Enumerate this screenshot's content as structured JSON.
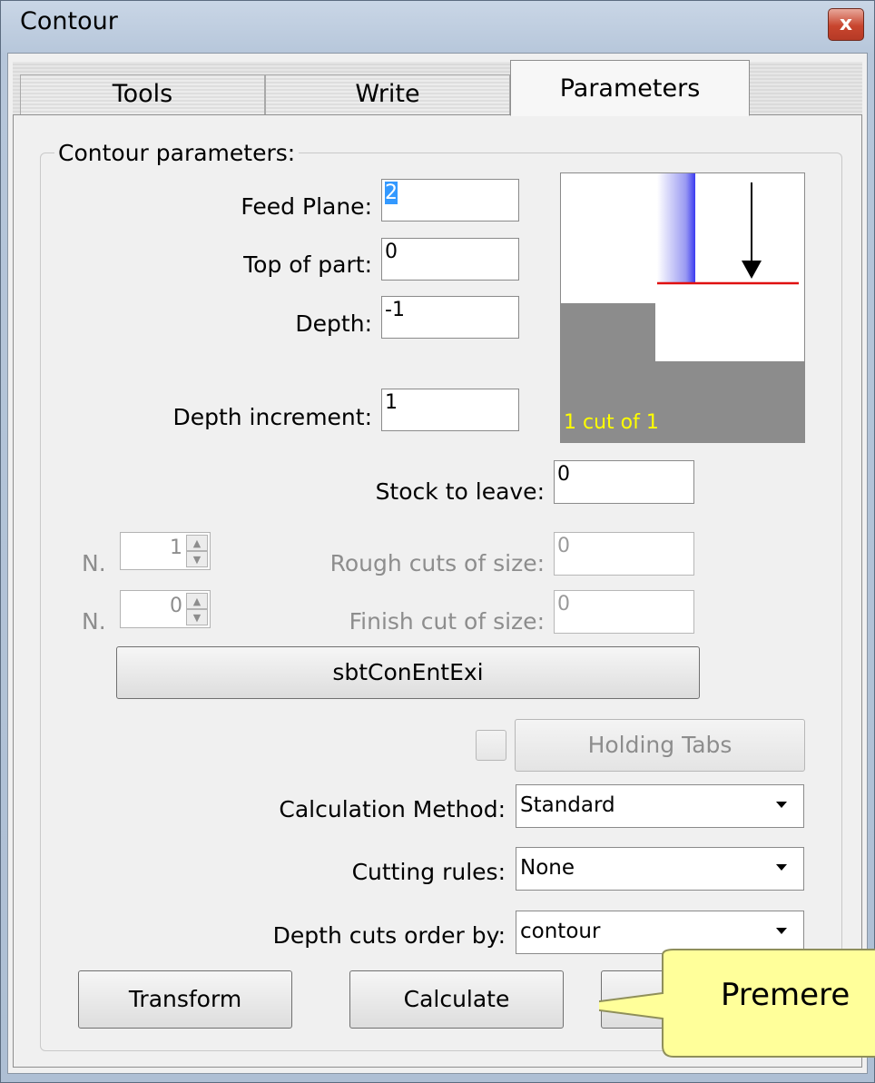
{
  "window": {
    "title": "Contour",
    "close_glyph": "x"
  },
  "tabs": [
    {
      "label": "Tools",
      "active": false
    },
    {
      "label": "Write",
      "active": false
    },
    {
      "label": "Parameters",
      "active": true
    }
  ],
  "group": {
    "label": "Contour parameters:"
  },
  "fields": {
    "feed_plane": {
      "label": "Feed Plane:",
      "value": "2"
    },
    "top_of_part": {
      "label": "Top of part:",
      "value": "0"
    },
    "depth": {
      "label": "Depth:",
      "value": "-1"
    },
    "depth_increment": {
      "label": "Depth increment:",
      "value": "1"
    },
    "stock_to_leave": {
      "label": "Stock to leave:",
      "value": "0"
    },
    "rough_cuts": {
      "label": "Rough cuts of size:",
      "value": "0"
    },
    "finish_cut": {
      "label": "Finish cut of size:",
      "value": "0"
    }
  },
  "preview": {
    "caption": "1 cut of 1"
  },
  "spinners": [
    {
      "prefix": "N.",
      "value": "1"
    },
    {
      "prefix": "N.",
      "value": "0"
    }
  ],
  "buttons": {
    "entry_exit": "sbtConEntExi",
    "holding_tabs": "Holding Tabs",
    "transform": "Transform",
    "calculate": "Calculate"
  },
  "combos": {
    "calculation_method": {
      "label": "Calculation Method:",
      "value": "Standard"
    },
    "cutting_rules": {
      "label": "Cutting rules:",
      "value": "None"
    },
    "depth_cuts_order": {
      "label": "Depth cuts order by:",
      "value": "contour"
    }
  },
  "callout": {
    "text": "Premere"
  },
  "colors": {
    "preview_stock": "#8c8c8c",
    "preview_tool": "#3a3af0",
    "preview_line": "#e01010",
    "preview_caption": "#ffff00",
    "callout_fill": "#ffff9a"
  }
}
